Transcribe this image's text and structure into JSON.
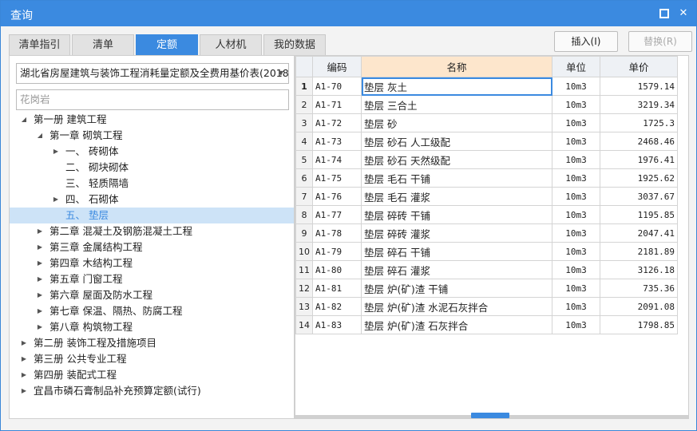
{
  "window": {
    "title": "查询"
  },
  "tabs": [
    {
      "label": "清单指引"
    },
    {
      "label": "清单"
    },
    {
      "label": "定额"
    },
    {
      "label": "人材机"
    },
    {
      "label": "我的数据"
    }
  ],
  "active_tab": "定额",
  "toolbar": {
    "insert_label": "插入(I)",
    "replace_label": "替换(R)"
  },
  "library_select": {
    "value": "湖北省房屋建筑与装饰工程消耗量定额及全费用基价表(2018"
  },
  "search": {
    "value": "花岗岩"
  },
  "tree": [
    {
      "label": "第一册 建筑工程",
      "level": 0,
      "toggle": "expanded"
    },
    {
      "label": "第一章 砌筑工程",
      "level": 1,
      "toggle": "expanded"
    },
    {
      "label": "一、 砖砌体",
      "level": 2,
      "toggle": "collapsed"
    },
    {
      "label": "二、 砌块砌体",
      "level": 2,
      "toggle": "none"
    },
    {
      "label": "三、 轻质隔墙",
      "level": 2,
      "toggle": "none"
    },
    {
      "label": "四、 石砌体",
      "level": 2,
      "toggle": "collapsed"
    },
    {
      "label": "五、 垫层",
      "level": 2,
      "toggle": "none",
      "selected": true
    },
    {
      "label": "第二章 混凝土及钢筋混凝土工程",
      "level": 1,
      "toggle": "collapsed"
    },
    {
      "label": "第三章 金属结构工程",
      "level": 1,
      "toggle": "collapsed"
    },
    {
      "label": "第四章 木结构工程",
      "level": 1,
      "toggle": "collapsed"
    },
    {
      "label": "第五章 门窗工程",
      "level": 1,
      "toggle": "collapsed"
    },
    {
      "label": "第六章 屋面及防水工程",
      "level": 1,
      "toggle": "collapsed"
    },
    {
      "label": "第七章 保温、隔热、防腐工程",
      "level": 1,
      "toggle": "collapsed"
    },
    {
      "label": "第八章 构筑物工程",
      "level": 1,
      "toggle": "collapsed"
    },
    {
      "label": "第二册 装饰工程及措施项目",
      "level": 0,
      "toggle": "collapsed"
    },
    {
      "label": "第三册 公共专业工程",
      "level": 0,
      "toggle": "collapsed"
    },
    {
      "label": "第四册 装配式工程",
      "level": 0,
      "toggle": "collapsed"
    },
    {
      "label": "宜昌市磷石膏制品补充预算定额(试行)",
      "level": 0,
      "toggle": "collapsed"
    }
  ],
  "grid": {
    "columns": {
      "code": "编码",
      "name": "名称",
      "unit": "单位",
      "price": "单价"
    },
    "rows": [
      {
        "no": "1",
        "code": "A1-70",
        "name": "垫层 灰土",
        "unit": "10m3",
        "price": "1579.14",
        "current": true
      },
      {
        "no": "2",
        "code": "A1-71",
        "name": "垫层 三合土",
        "unit": "10m3",
        "price": "3219.34"
      },
      {
        "no": "3",
        "code": "A1-72",
        "name": "垫层 砂",
        "unit": "10m3",
        "price": "1725.3"
      },
      {
        "no": "4",
        "code": "A1-73",
        "name": "垫层 砂石 人工级配",
        "unit": "10m3",
        "price": "2468.46"
      },
      {
        "no": "5",
        "code": "A1-74",
        "name": "垫层 砂石 天然级配",
        "unit": "10m3",
        "price": "1976.41"
      },
      {
        "no": "6",
        "code": "A1-75",
        "name": "垫层 毛石 干铺",
        "unit": "10m3",
        "price": "1925.62"
      },
      {
        "no": "7",
        "code": "A1-76",
        "name": "垫层 毛石 灌浆",
        "unit": "10m3",
        "price": "3037.67"
      },
      {
        "no": "8",
        "code": "A1-77",
        "name": "垫层 碎砖 干铺",
        "unit": "10m3",
        "price": "1195.85"
      },
      {
        "no": "9",
        "code": "A1-78",
        "name": "垫层 碎砖 灌浆",
        "unit": "10m3",
        "price": "2047.41"
      },
      {
        "no": "10",
        "code": "A1-79",
        "name": "垫层 碎石 干铺",
        "unit": "10m3",
        "price": "2181.89"
      },
      {
        "no": "11",
        "code": "A1-80",
        "name": "垫层 碎石 灌浆",
        "unit": "10m3",
        "price": "3126.18"
      },
      {
        "no": "12",
        "code": "A1-81",
        "name": "垫层 炉(矿)渣 干铺",
        "unit": "10m3",
        "price": "735.36"
      },
      {
        "no": "13",
        "code": "A1-82",
        "name": "垫层 炉(矿)渣 水泥石灰拌合",
        "unit": "10m3",
        "price": "2091.08"
      },
      {
        "no": "14",
        "code": "A1-83",
        "name": "垫层 炉(矿)渣 石灰拌合",
        "unit": "10m3",
        "price": "1798.85"
      }
    ]
  },
  "colors": {
    "accent": "#3b8ae0",
    "name_header_bg": "#fde6cc",
    "tree_selected_bg": "#cde3f7"
  },
  "icons": {
    "maximize": "maximize-icon",
    "close": "close-icon",
    "dropdown": "chevron-down-icon",
    "expanded": "triangle-down-icon",
    "collapsed": "triangle-right-icon"
  }
}
